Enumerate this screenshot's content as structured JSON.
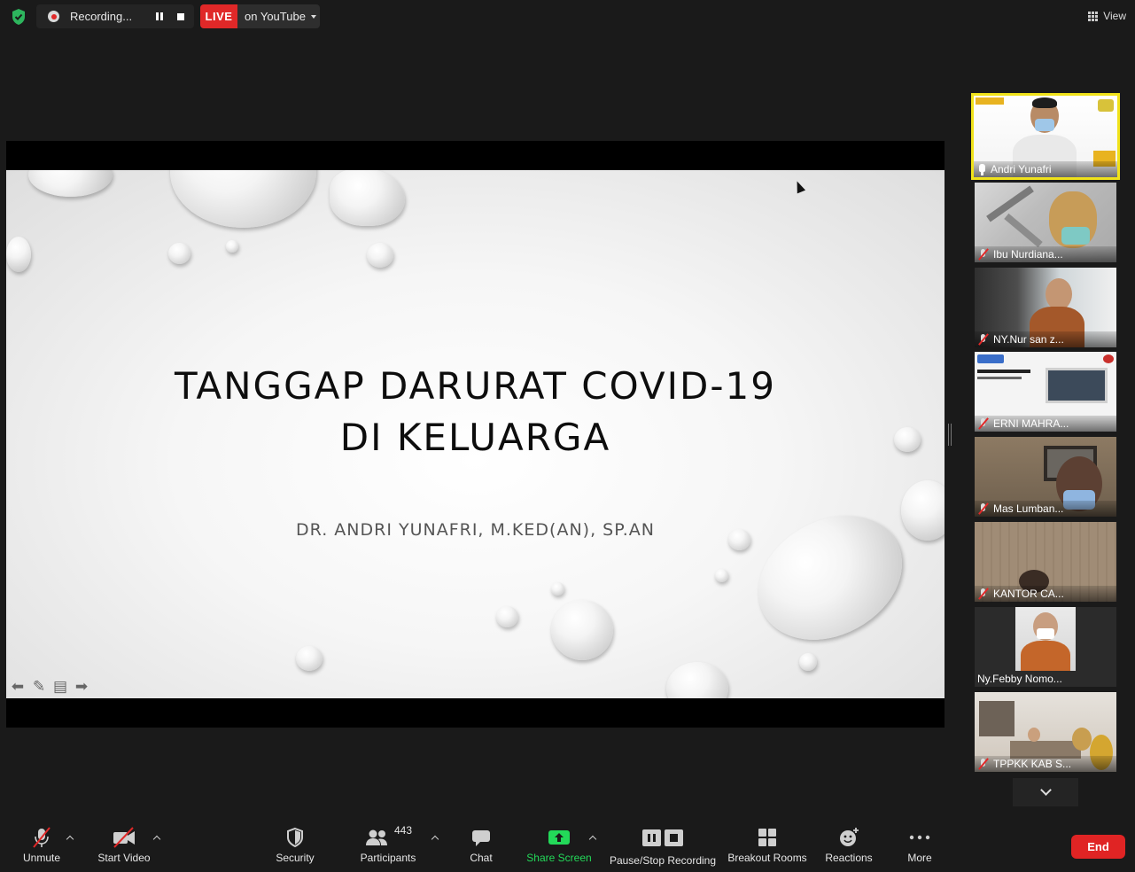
{
  "top_bar": {
    "recording_label": "Recording...",
    "live_badge": "LIVE",
    "live_destination": "on YouTube",
    "view_label": "View"
  },
  "slide": {
    "title_line1": "TANGGAP DARURAT COVID-19",
    "title_line2": "DI KELUARGA",
    "presenter": "DR. ANDRI YUNAFRI, M.KED(AN), SP.AN"
  },
  "gallery": {
    "participants": [
      {
        "name": "Andri Yunafri",
        "status": "hand-raised",
        "active_speaker": true
      },
      {
        "name": "Ibu Nurdiana...",
        "status": "muted"
      },
      {
        "name": "NY.Nur san z...",
        "status": "muted"
      },
      {
        "name": "ERNI MAHRA...",
        "status": "muted"
      },
      {
        "name": "Mas Lumban...",
        "status": "muted"
      },
      {
        "name": "KANTOR CA...",
        "status": "muted"
      },
      {
        "name": "Ny.Febby Nomo...",
        "status": "none"
      },
      {
        "name": "TPPKK KAB S...",
        "status": "muted"
      }
    ]
  },
  "toolbar": {
    "unmute": "Unmute",
    "start_video": "Start Video",
    "security": "Security",
    "participants": "Participants",
    "participants_count": "443",
    "chat": "Chat",
    "share_screen": "Share Screen",
    "pause_stop_recording": "Pause/Stop Recording",
    "breakout_rooms": "Breakout Rooms",
    "reactions": "Reactions",
    "more": "More",
    "end": "End"
  },
  "colors": {
    "background": "#1a1a1a",
    "live_red": "#e02828",
    "end_red": "#e02424",
    "share_green": "#23d959",
    "active_speaker_border": "#f0e21a",
    "encryption_green": "#2db55d"
  }
}
